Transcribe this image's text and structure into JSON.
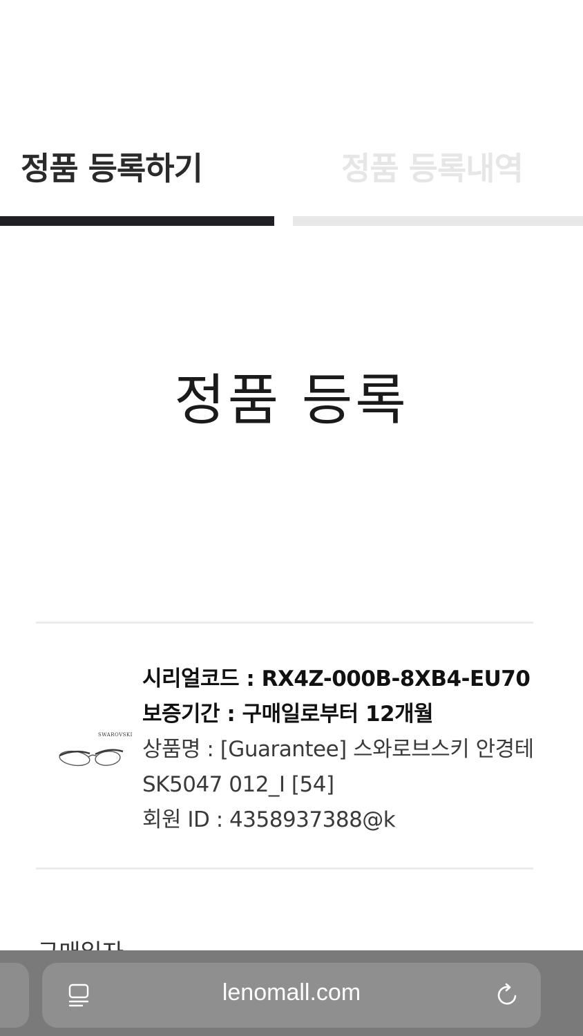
{
  "tabs": [
    {
      "label": "정품 등록하기",
      "active": true
    },
    {
      "label": "정품 등록내역",
      "active": false
    }
  ],
  "page": {
    "title": "정품 등록"
  },
  "product": {
    "brand": "SWAROVSKI",
    "serial_line": "시리얼코드 : RX4Z-000B-8XB4-EU70",
    "warranty_line": "보증기간 : 구매일로부터 12개월",
    "name_line_1": "상품명 : [Guarantee] 스와로브스키 안경테",
    "name_line_2": "SK5047 012_I [54]",
    "member_line": "회원 ID : 4358937388@k"
  },
  "next_section_label": "구매일자",
  "browser": {
    "url": "lenomall.com"
  },
  "colors": {
    "active_tab": "#1f1f26",
    "inactive_tab": "#e8e8e8",
    "browser_bar": "#7a7a7a"
  },
  "icons": [
    "glasses-product-image",
    "reader-mode-icon",
    "reload-icon"
  ]
}
